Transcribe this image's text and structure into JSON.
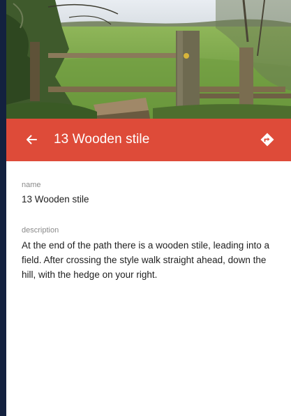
{
  "toolbar": {
    "title": "13 Wooden stile",
    "back_icon": "arrow-left-icon",
    "directions_icon": "directions-icon",
    "color": "#de4b39"
  },
  "hero": {
    "image": "wooden-stile-photo"
  },
  "details": {
    "name_label": "name",
    "name_value": "13 Wooden stile",
    "description_label": "description",
    "description_value": "At the end of the path there is a wooden stile, leading into a field. After crossing the style walk straight ahead, down the hill, with the hedge on your right."
  }
}
